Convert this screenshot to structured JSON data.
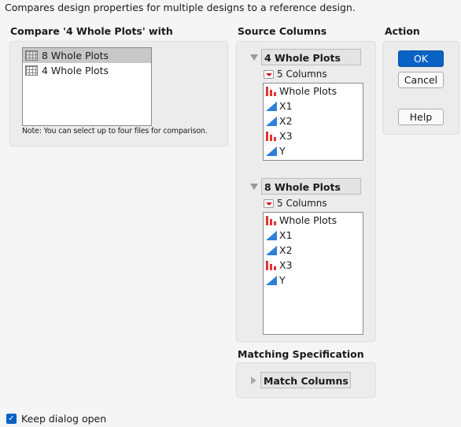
{
  "description": "Compares design properties for multiple designs to a reference design.",
  "compare": {
    "title": "Compare '4 Whole Plots' with",
    "files": [
      {
        "name": "8 Whole Plots",
        "selected": true
      },
      {
        "name": "4 Whole Plots",
        "selected": false
      }
    ],
    "note": "Note: You can select up to four files for comparison."
  },
  "source_columns": {
    "title": "Source Columns",
    "tables": [
      {
        "name": "4 Whole Plots",
        "count_label": "5 Columns",
        "columns": [
          {
            "name": "Whole Plots",
            "type": "nominal"
          },
          {
            "name": "X1",
            "type": "continuous"
          },
          {
            "name": "X2",
            "type": "continuous"
          },
          {
            "name": "X3",
            "type": "nominal"
          },
          {
            "name": "Y",
            "type": "continuous"
          }
        ]
      },
      {
        "name": "8 Whole Plots",
        "count_label": "5 Columns",
        "columns": [
          {
            "name": "Whole Plots",
            "type": "nominal"
          },
          {
            "name": "X1",
            "type": "continuous"
          },
          {
            "name": "X2",
            "type": "continuous"
          },
          {
            "name": "X3",
            "type": "nominal"
          },
          {
            "name": "Y",
            "type": "continuous"
          }
        ]
      }
    ]
  },
  "matching": {
    "title": "Matching Specification",
    "item": "Match Columns"
  },
  "action": {
    "title": "Action",
    "ok": "OK",
    "cancel": "Cancel",
    "help": "Help"
  },
  "keep_open": {
    "label": "Keep dialog open",
    "checked": true
  },
  "colors": {
    "accent": "#0a63c4",
    "nominal_icon": "#e23333",
    "continuous_icon": "#2e7fd8",
    "dropdown_arrow": "#d01818"
  }
}
